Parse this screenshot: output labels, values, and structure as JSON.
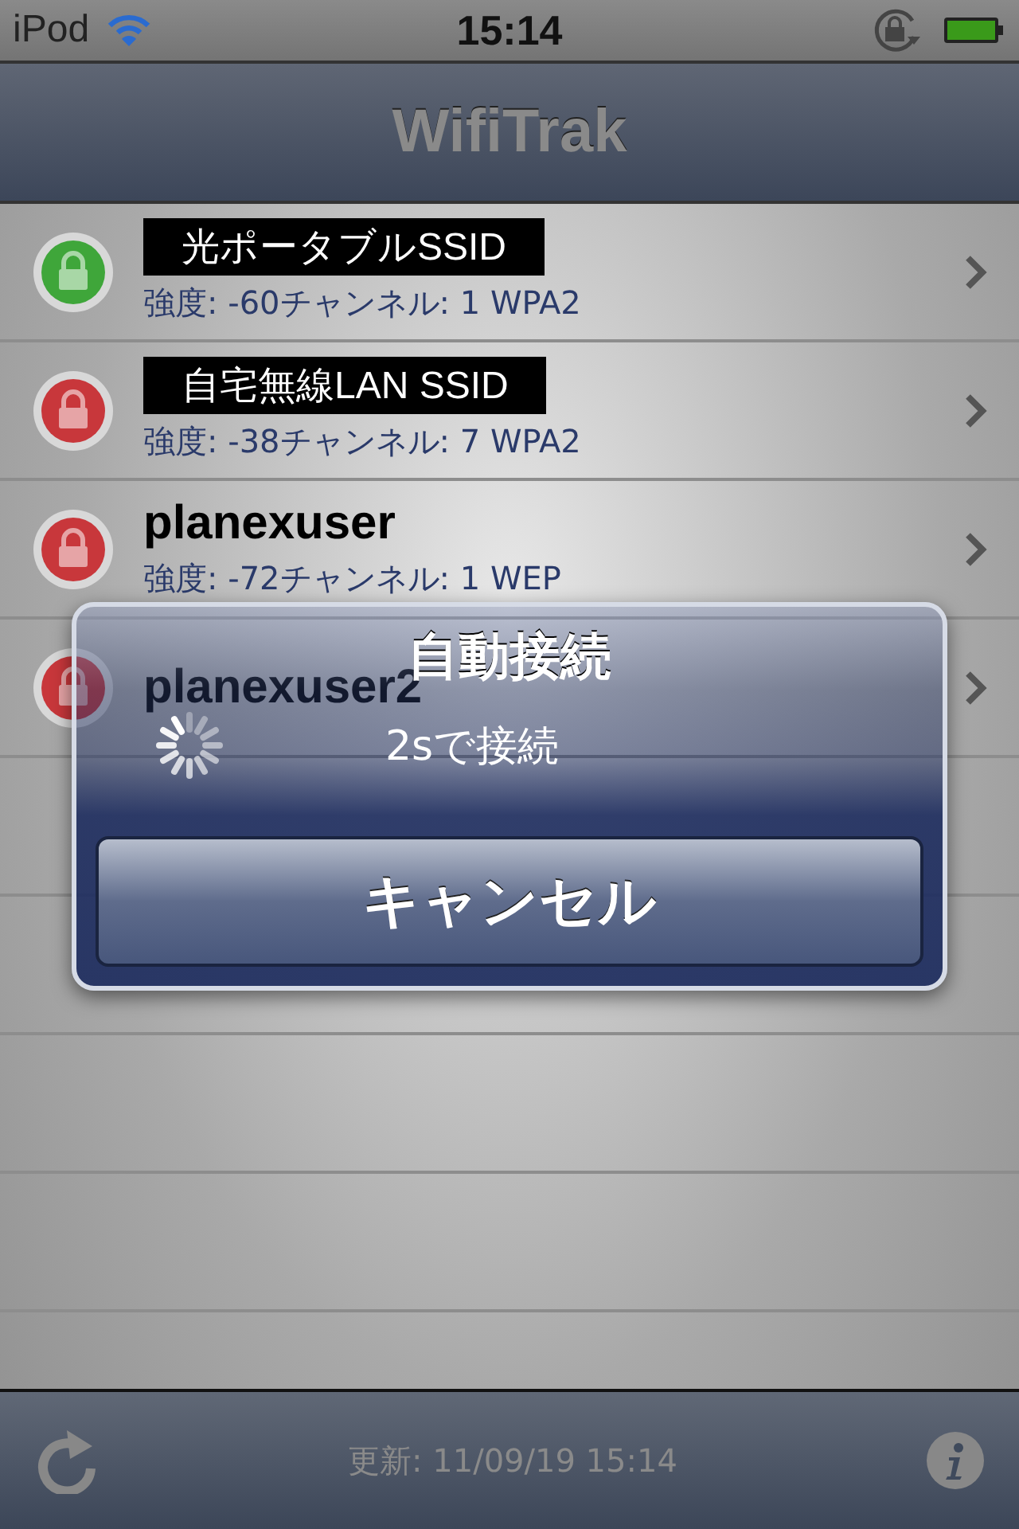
{
  "status_bar": {
    "device": "iPod",
    "time": "15:14"
  },
  "nav_bar": {
    "title": "WifiTrak"
  },
  "networks": [
    {
      "name": "光ポータブルSSID",
      "redacted": true,
      "detail": "強度: -60チャンネル: 1 WPA2",
      "color": "#3fa63a"
    },
    {
      "name": "自宅無線LAN SSID",
      "redacted": true,
      "detail": "強度: -38チャンネル: 7 WPA2",
      "color": "#c8373b"
    },
    {
      "name": "planexuser",
      "redacted": false,
      "detail": "強度: -72チャンネル: 1 WEP",
      "color": "#c8373b"
    },
    {
      "name": "planexuser2",
      "redacted": false,
      "color": "#c8373b"
    }
  ],
  "alert": {
    "title": "自動接続",
    "message": "2sで接続",
    "button": "キャンセル"
  },
  "toolbar": {
    "updated": "更新: 11/09/19 15:14"
  }
}
